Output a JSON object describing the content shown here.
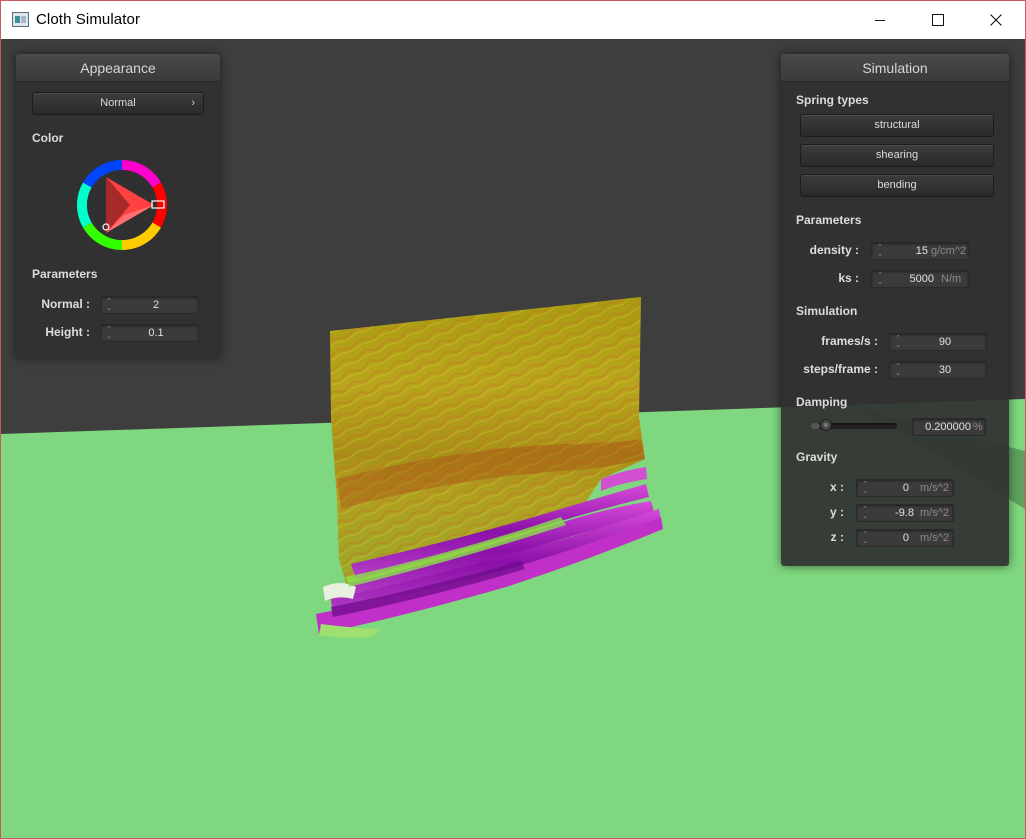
{
  "window": {
    "title": "Cloth Simulator",
    "icon": "app-window-icon",
    "controls": {
      "minimize": "minimize-icon",
      "maximize": "maximize-icon",
      "close": "close-icon"
    }
  },
  "appearance": {
    "title": "Appearance",
    "shader_dropdown": {
      "value": "Normal",
      "icon": "chevron-right-icon"
    },
    "color_label": "Color",
    "color_wheel": {
      "selected_hue": "#ff0000"
    },
    "parameters_label": "Parameters",
    "fields": [
      {
        "label": "Normal :",
        "value": "2"
      },
      {
        "label": "Height :",
        "value": "0.1"
      }
    ]
  },
  "simulation": {
    "title": "Simulation",
    "spring_types_label": "Spring types",
    "spring_buttons": [
      "structural",
      "shearing",
      "bending"
    ],
    "parameters_label": "Parameters",
    "parameters": [
      {
        "label": "density :",
        "value": "15",
        "unit": "g/cm^2"
      },
      {
        "label": "ks :",
        "value": "5000",
        "unit": "N/m"
      }
    ],
    "simulation_label": "Simulation",
    "sim_fields": [
      {
        "label": "frames/s :",
        "value": "90"
      },
      {
        "label": "steps/frame :",
        "value": "30"
      }
    ],
    "damping_label": "Damping",
    "damping": {
      "value": "0.200000",
      "unit": "%",
      "slider_fraction": 0.1
    },
    "gravity_label": "Gravity",
    "gravity": [
      {
        "label": "x :",
        "value": "0",
        "unit": "m/s^2"
      },
      {
        "label": "y :",
        "value": "-9.8",
        "unit": "m/s^2"
      },
      {
        "label": "z :",
        "value": "0",
        "unit": "m/s^2"
      }
    ]
  },
  "colors": {
    "background": "#3e3e3e",
    "ground": "#7fd87f",
    "panel": "#303030",
    "cloth_base": "#b3a010",
    "cloth_folds": "#9a16b0"
  }
}
